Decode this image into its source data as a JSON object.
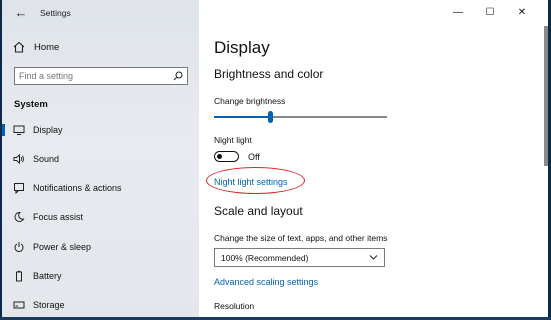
{
  "window": {
    "title": "Settings",
    "controls": [
      "—",
      "☐",
      "✕"
    ]
  },
  "sidebar": {
    "home_label": "Home",
    "search": {
      "placeholder": "Find a setting"
    },
    "section": "System",
    "items": [
      {
        "label": "Display",
        "icon": "monitor-icon",
        "active": true
      },
      {
        "label": "Sound",
        "icon": "speaker-icon"
      },
      {
        "label": "Notifications & actions",
        "icon": "notification-icon"
      },
      {
        "label": "Focus assist",
        "icon": "moon-icon"
      },
      {
        "label": "Power & sleep",
        "icon": "power-icon"
      },
      {
        "label": "Battery",
        "icon": "battery-icon"
      },
      {
        "label": "Storage",
        "icon": "storage-icon"
      }
    ]
  },
  "content": {
    "title": "Display",
    "brightness_heading": "Brightness and color",
    "brightness_label": "Change brightness",
    "brightness_value": 0.31,
    "night_light_label": "Night light",
    "night_light_state": "Off",
    "night_light_link": "Night light settings",
    "scale_heading": "Scale and layout",
    "scale_label": "Change the size of text, apps, and other items",
    "scale_value": "100% (Recommended)",
    "advanced_link": "Advanced scaling settings",
    "resolution_label": "Resolution"
  },
  "colors": {
    "accent": "#0063b1",
    "highlight": "#e0232a"
  }
}
